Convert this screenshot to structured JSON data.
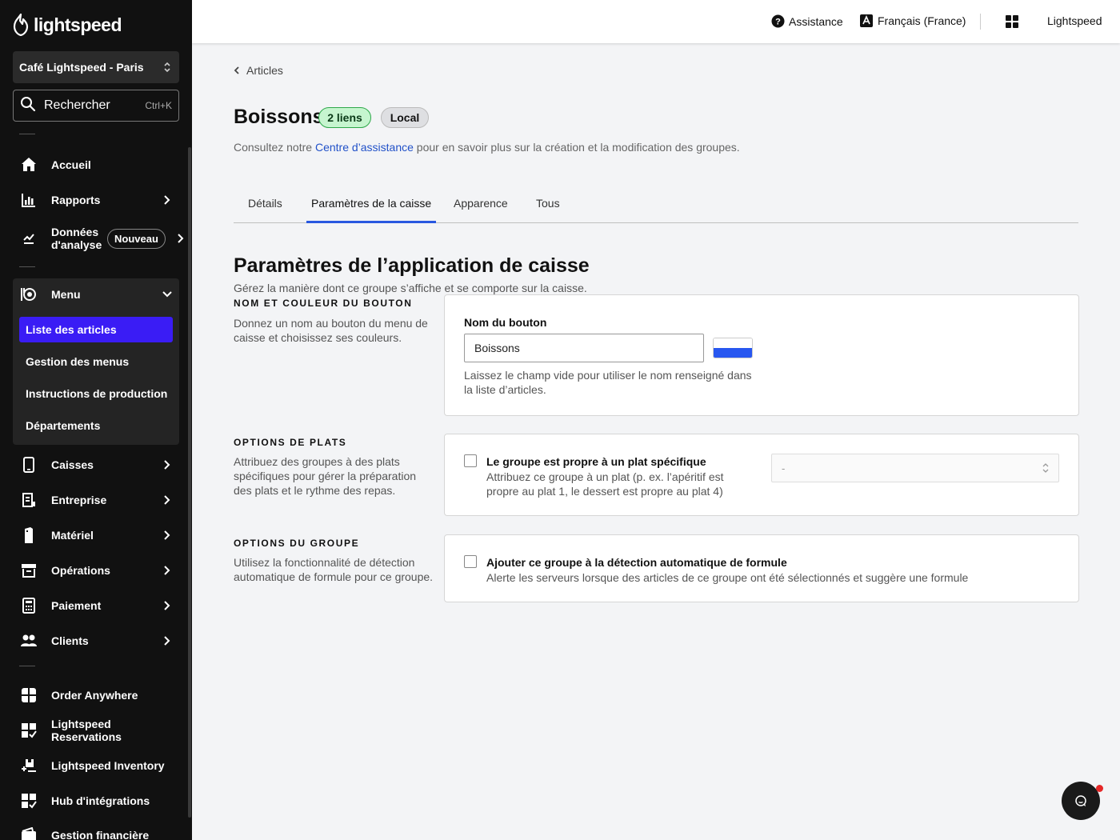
{
  "brand": {
    "logo_text": "lightspeed"
  },
  "store": {
    "name": "Café Lightspeed - Paris"
  },
  "search": {
    "label": "Rechercher",
    "shortcut": "Ctrl+K"
  },
  "sidebar": {
    "items": [
      {
        "label": "Accueil",
        "icon": "home-icon"
      },
      {
        "label": "Rapports",
        "icon": "bar-chart-icon"
      },
      {
        "label": "Données d'analyse",
        "icon": "analytics-icon",
        "badge": "Nouveau"
      },
      {
        "label": "Menu",
        "icon": "menu-icon"
      },
      {
        "label": "Caisses",
        "icon": "tablet-icon"
      },
      {
        "label": "Entreprise",
        "icon": "building-icon"
      },
      {
        "label": "Matériel",
        "icon": "device-icon"
      },
      {
        "label": "Opérations",
        "icon": "archive-icon"
      },
      {
        "label": "Paiement",
        "icon": "calculator-icon"
      },
      {
        "label": "Clients",
        "icon": "users-icon"
      },
      {
        "label": "Order Anywhere",
        "icon": "order-icon"
      },
      {
        "label": "Lightspeed Reservations",
        "icon": "reservations-icon"
      },
      {
        "label": "Lightspeed Inventory",
        "icon": "inventory-icon"
      },
      {
        "label": "Hub d'intégrations",
        "icon": "integrations-icon"
      },
      {
        "label": "Gestion financière",
        "icon": "wallet-icon"
      }
    ],
    "analytics_line1": "Données",
    "analytics_line2": "d'analyse",
    "menu_sub": [
      {
        "label": "Liste des articles",
        "active": true
      },
      {
        "label": "Gestion des menus"
      },
      {
        "label": "Instructions de production"
      },
      {
        "label": "Départements"
      }
    ]
  },
  "topbar": {
    "help": "Assistance",
    "language": "Français (France)",
    "account": "Lightspeed"
  },
  "page": {
    "breadcrumb": "Articles",
    "title": "Boissons",
    "badge_links": "2 liens",
    "badge_local": "Local",
    "subtitle_before": "Consultez notre ",
    "subtitle_link": "Centre d’assistance",
    "subtitle_after": " pour en savoir plus sur la création et la modification des groupes.",
    "tabs": [
      "Détails",
      "Paramètres de la caisse",
      "Apparence",
      "Tous"
    ],
    "active_tab": "Paramètres de la caisse"
  },
  "settings": {
    "title": "Paramètres de l’application de caisse",
    "description": "Gérez la manière dont ce groupe s’affiche et se comporte sur la caisse.",
    "button_section": {
      "heading": "NOM ET COULEUR DU BOUTON",
      "description": "Donnez un nom au bouton du menu de caisse et choisissez ses couleurs.",
      "field_label": "Nom du bouton",
      "field_value": "Boissons",
      "help": "Laissez le champ vide pour utiliser le nom renseigné dans la liste d’articles.",
      "swatch_color": "#2857f0"
    },
    "course_section": {
      "heading": "OPTIONS DE PLATS",
      "description": "Attribuez des groupes à des plats spécifiques pour gérer la préparation des plats et le rythme des repas.",
      "checkbox_title": "Le groupe est propre à un plat spécifique",
      "checkbox_desc": "Attribuez ce groupe à un plat (p. ex. l’apéritif est propre au plat 1, le dessert est propre au plat 4)",
      "checked": false,
      "select_value": "-"
    },
    "group_section": {
      "heading": "OPTIONS DU GROUPE",
      "description": "Utilisez la fonctionnalité de détection automatique de formule pour ce groupe.",
      "checkbox_title": "Ajouter ce groupe à la détection automatique de formule",
      "checkbox_desc": "Alerte les serveurs lorsque des articles de ce groupe ont été sélectionnés et suggère une formule",
      "checked": false
    }
  },
  "colors": {
    "sidebar_bg": "#111111",
    "active_nav": "#3a1cf5",
    "tab_accent": "#2858e0",
    "link": "#2151c8"
  }
}
